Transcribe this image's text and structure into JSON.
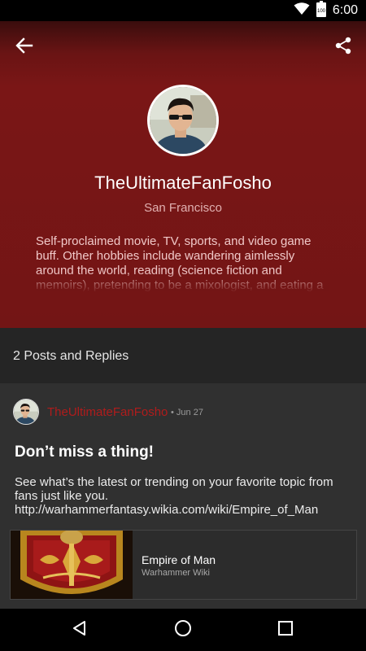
{
  "status_bar": {
    "time": "6:00",
    "battery_level": "100",
    "icons": [
      "wifi-icon",
      "battery-icon"
    ]
  },
  "header": {
    "back_icon": "arrow-back-icon",
    "share_icon": "share-icon"
  },
  "profile": {
    "username": "TheUltimateFanFosho",
    "location": "San Francisco",
    "bio": "Self-proclaimed movie, TV, sports, and video game buff. Other hobbies include wandering aimlessly around the world, reading (science fiction and memoirs), pretending to be a mixologist, and eating a"
  },
  "posts": {
    "count_label": "2 Posts and Replies",
    "items": [
      {
        "author": "TheUltimateFanFosho",
        "date": "• Jun 27",
        "title": "Don’t miss a thing!",
        "body": "See what’s the latest or trending on your favorite topic from fans just like you. http://warhammerfantasy.wikia.com/wiki/Empire_of_Man",
        "link": {
          "title": "Empire of Man",
          "source": "Warhammer Wiki"
        }
      }
    ]
  },
  "nav_bar": {
    "icons": [
      "back-triangle-icon",
      "home-circle-icon",
      "recents-square-icon"
    ]
  },
  "colors": {
    "hero_red": "#7a1616",
    "author_red": "#b01c1c",
    "card_bg": "#303030",
    "header_bg": "#252525"
  }
}
